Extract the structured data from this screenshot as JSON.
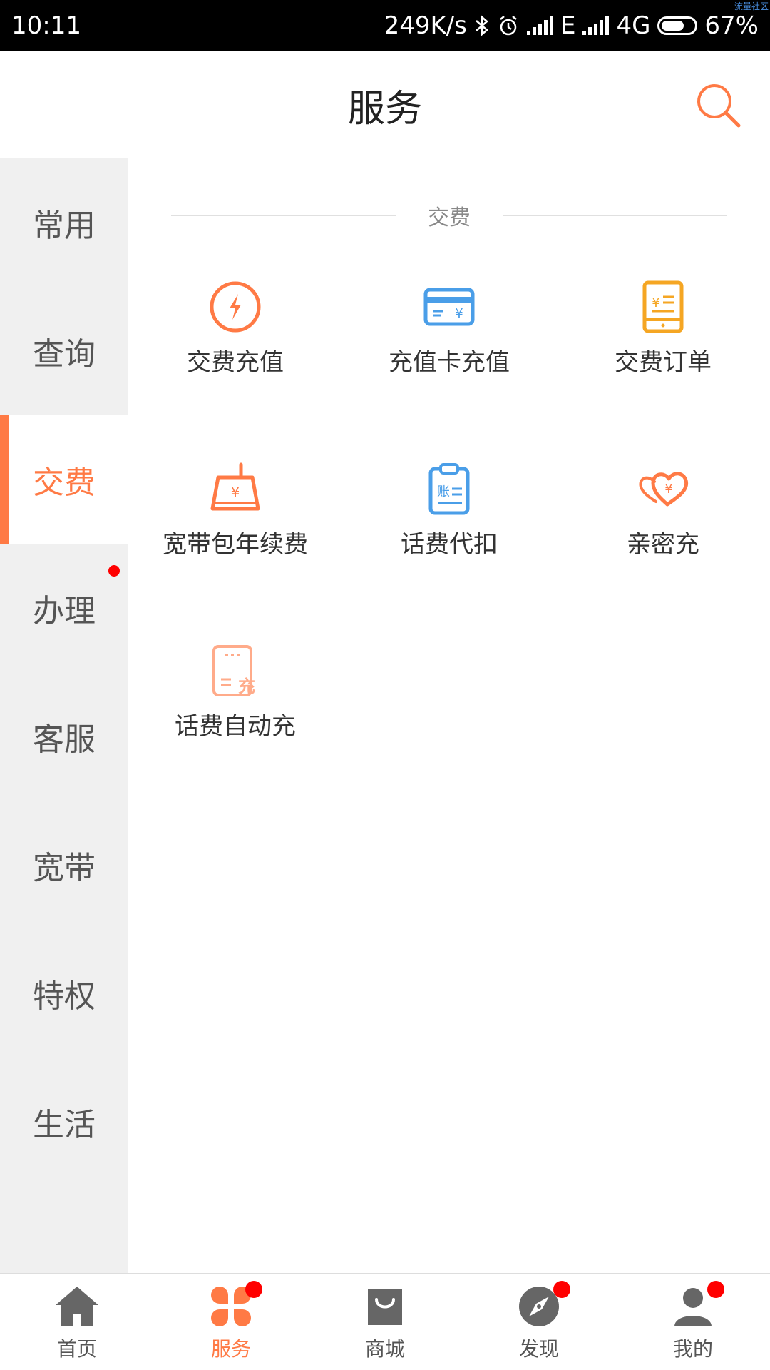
{
  "status_bar": {
    "time": "10:11",
    "speed": "249K/s",
    "net_e": "E",
    "net_4g": "4G",
    "battery": "67%",
    "watermark": "流量社区"
  },
  "header": {
    "title": "服务"
  },
  "sidebar": {
    "items": [
      {
        "label": "常用"
      },
      {
        "label": "查询"
      },
      {
        "label": "交费"
      },
      {
        "label": "办理"
      },
      {
        "label": "客服"
      },
      {
        "label": "宽带"
      },
      {
        "label": "特权"
      },
      {
        "label": "生活"
      }
    ],
    "active": "交费"
  },
  "section": {
    "title": "交费",
    "items": [
      {
        "label": "交费充值",
        "icon": "bolt-circle-icon"
      },
      {
        "label": "充值卡充值",
        "icon": "card-icon"
      },
      {
        "label": "交费订单",
        "icon": "order-icon"
      },
      {
        "label": "宽带包年续费",
        "icon": "router-icon"
      },
      {
        "label": "话费代扣",
        "icon": "clipboard-icon"
      },
      {
        "label": "亲密充",
        "icon": "hearts-icon"
      },
      {
        "label": "话费自动充",
        "icon": "auto-charge-icon"
      }
    ]
  },
  "bottom_nav": {
    "items": [
      {
        "label": "首页"
      },
      {
        "label": "服务"
      },
      {
        "label": "商城"
      },
      {
        "label": "发现"
      },
      {
        "label": "我的"
      }
    ]
  },
  "colors": {
    "accent": "#ff7a45",
    "blue": "#4a9ee8",
    "gold": "#f5a623",
    "badge": "#ff0000"
  }
}
